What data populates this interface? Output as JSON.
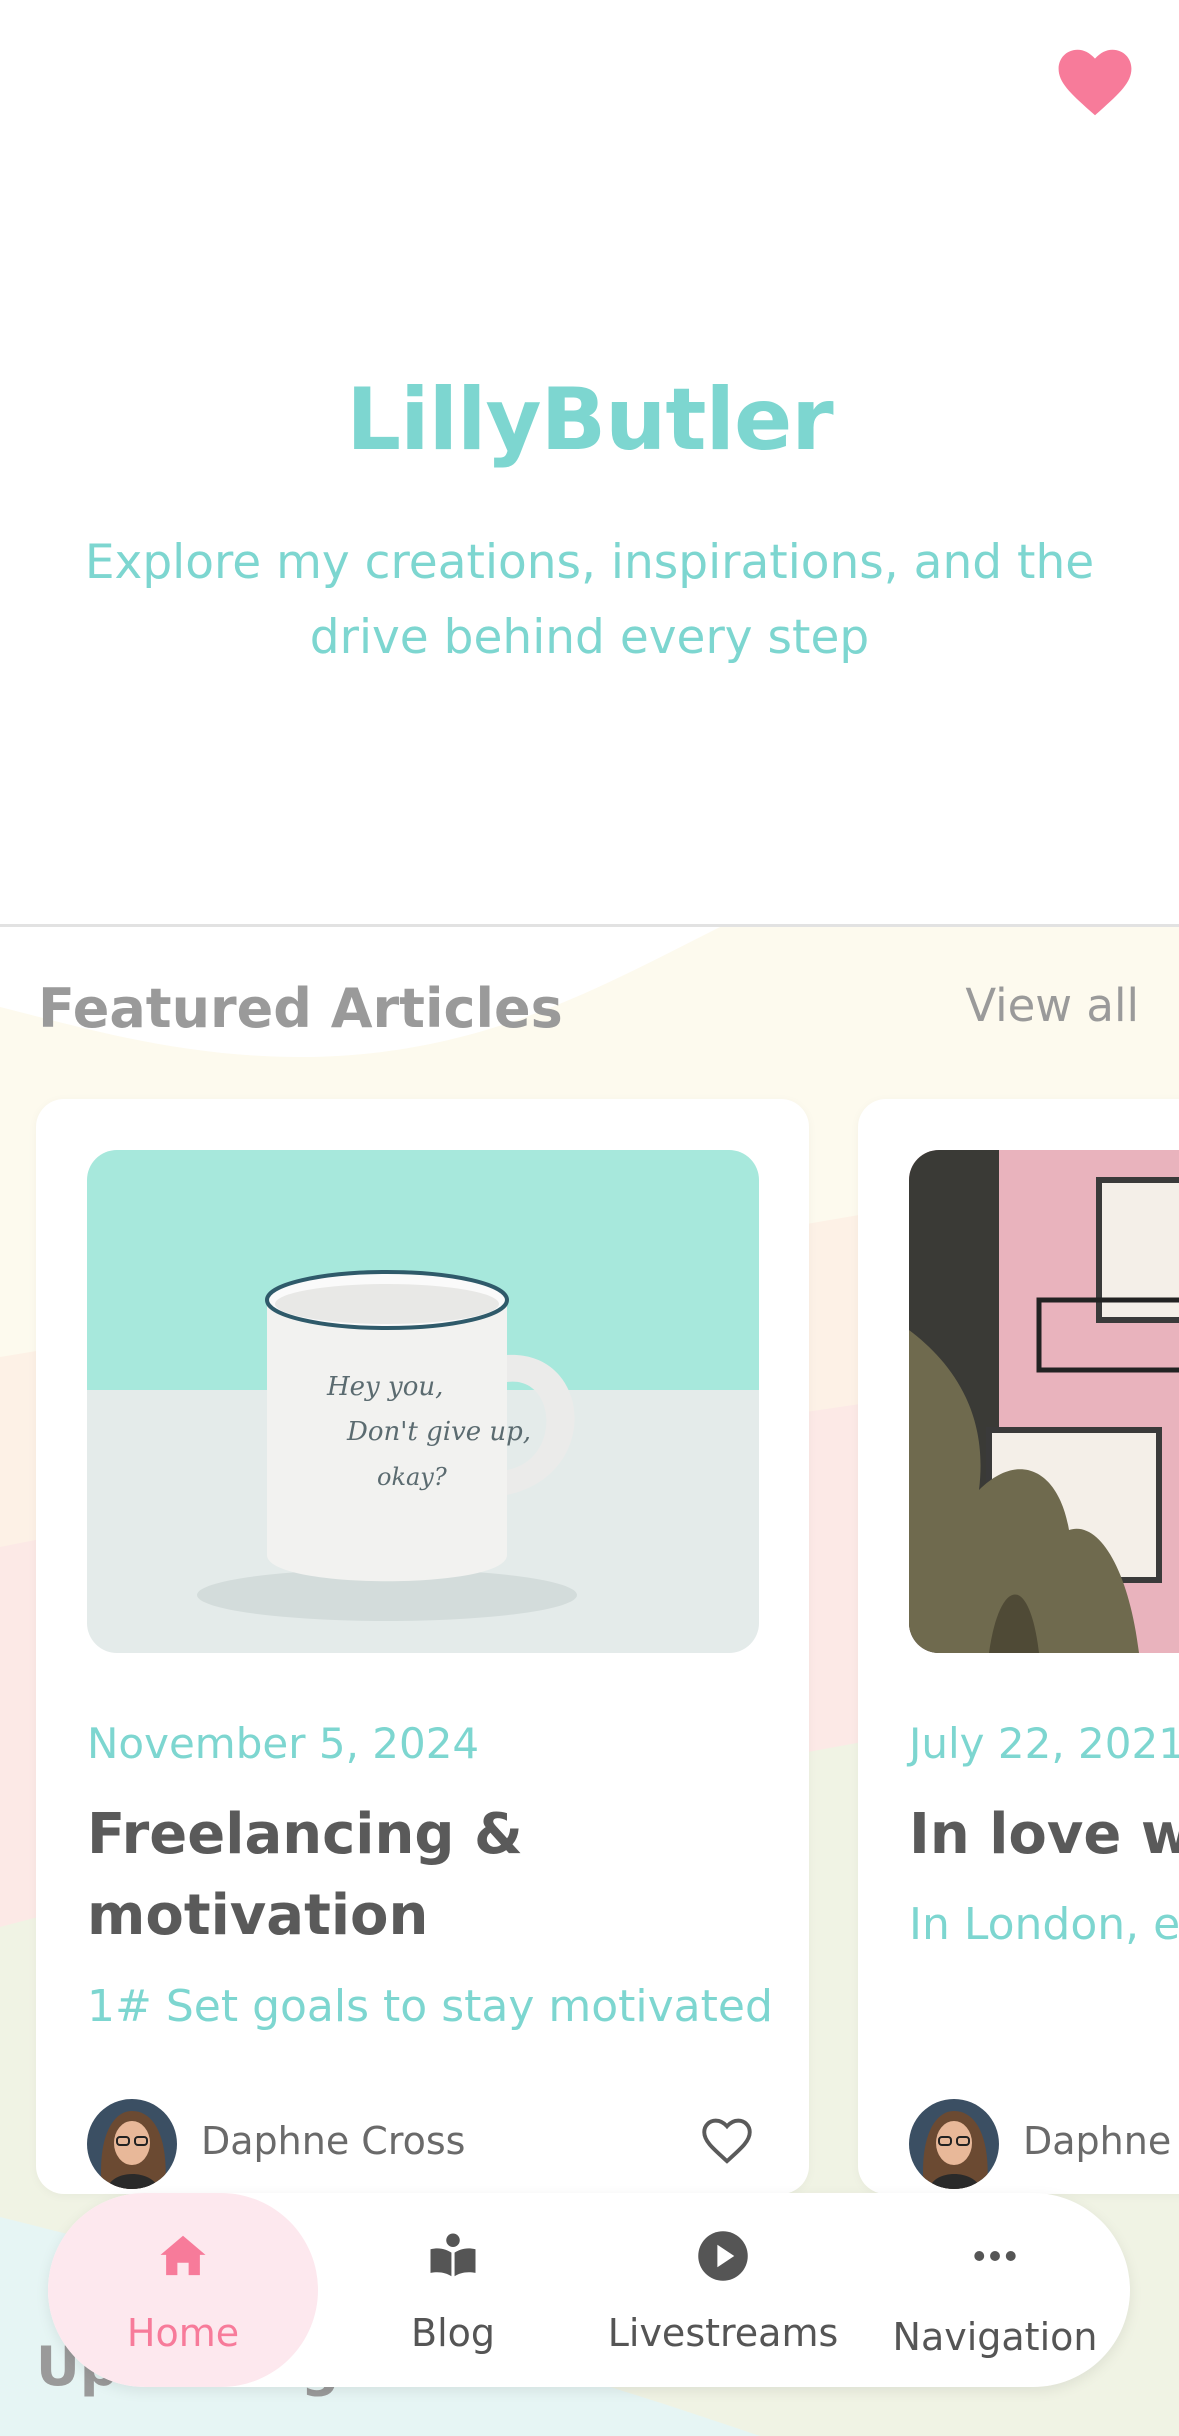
{
  "header": {
    "title": "LillyButler",
    "tagline": "Explore my creations, inspirations, and the drive behind every step",
    "favorite_icon": "heart-icon"
  },
  "featured": {
    "title": "Featured Articles",
    "view_all": "View all",
    "articles": [
      {
        "date": "November 5, 2024",
        "title": "Freelancing & motivation",
        "excerpt": "1# Set goals to stay motivated",
        "author": "Daphne Cross",
        "image": "white mug with handwritten text on teal background",
        "mug_text": [
          "Hey you,",
          "Don't give up,",
          "okay?"
        ]
      },
      {
        "date": "July 22, 2021",
        "title": "In love wit",
        "excerpt": "In London, ev",
        "author": "Daphne C",
        "image": "pink brick building with balcony"
      }
    ]
  },
  "upcoming": {
    "title": "Upcoming Livestreams"
  },
  "bottom_nav": {
    "items": [
      {
        "label": "Home",
        "icon": "home-icon",
        "active": true
      },
      {
        "label": "Blog",
        "icon": "book-icon",
        "active": false
      },
      {
        "label": "Livestreams",
        "icon": "play-icon",
        "active": false
      },
      {
        "label": "Navigation",
        "icon": "more-icon",
        "active": false
      }
    ]
  },
  "colors": {
    "accent_teal": "#7dd6d0",
    "accent_pink": "#f77b9a",
    "text_gray": "#5a5a5a"
  }
}
